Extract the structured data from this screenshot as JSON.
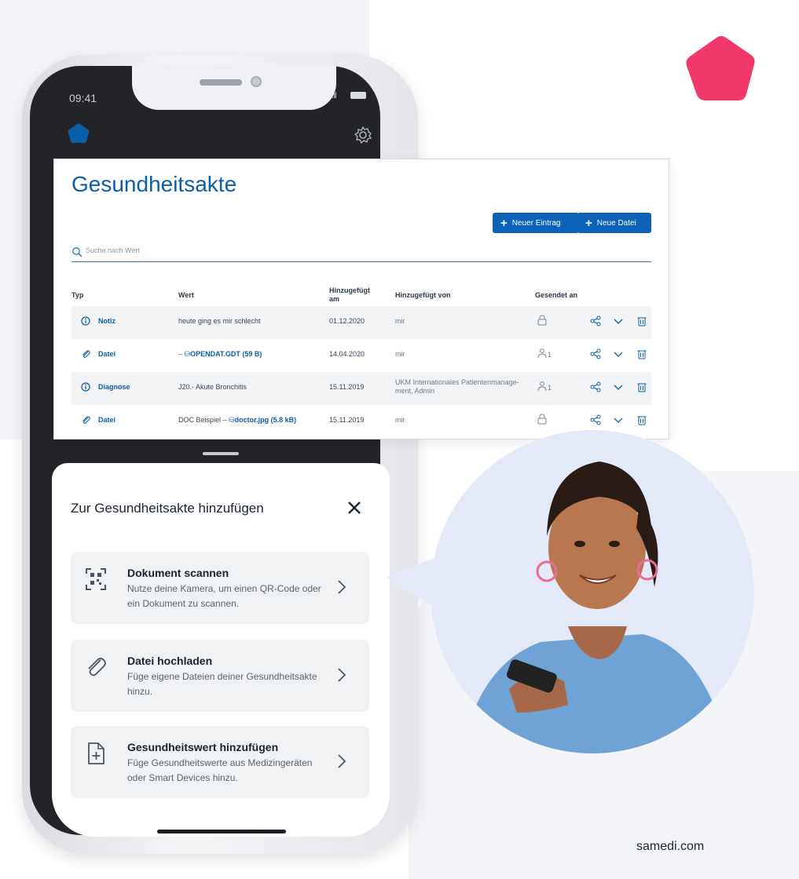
{
  "phone": {
    "status_time": "09:41",
    "status_signal": "..ıl"
  },
  "desktop": {
    "title": "Gesundheitsakte",
    "btn_new_entry": "Neuer Eintrag",
    "btn_new_file": "Neue Datei",
    "search_placeholder": "Suche nach Wert",
    "headers": {
      "typ": "Typ",
      "wert": "Wert",
      "added_at_line1": "Hinzugefügt",
      "added_at_line2": "am",
      "added_by": "Hinzugefügt von",
      "sent_to": "Gesendet an"
    },
    "rows": [
      {
        "type": "Notiz",
        "icon": "info-icon",
        "wert_prefix": "",
        "wert": "heute ging es mir schlecht",
        "date": "01.12.2020",
        "by_line1": "mir",
        "by_line2": "",
        "sent": "lock-icon",
        "count": ""
      },
      {
        "type": "Datei",
        "icon": "paperclip-icon",
        "wert_prefix": "– ",
        "wert": "OPENDAT.GDT (59 B)",
        "date": "14.04.2020",
        "by_line1": "mir",
        "by_line2": "",
        "sent": "users-icon",
        "count": "1"
      },
      {
        "type": "Diagnose",
        "icon": "info-icon",
        "wert_prefix": "",
        "wert": "J20.- Akute Bronchitis",
        "date": "15.11.2019",
        "by_line1": "UKM Internationales Patientenmanage-",
        "by_line2": "ment, Admin",
        "sent": "users-icon",
        "count": "1"
      },
      {
        "type": "Datei",
        "icon": "paperclip-icon",
        "wert_prefix": "DOC Beispiel – ",
        "wert": "doctor.jpg (5.8 kB)",
        "date": "15.11.2019",
        "by_line1": "mir",
        "by_line2": "",
        "sent": "lock-icon",
        "count": ""
      }
    ]
  },
  "sheet": {
    "title": "Zur Gesundheitsakte hinzufügen",
    "cards": [
      {
        "title": "Dokument scannen",
        "desc": "Nutze deine Kamera, um einen QR-Code oder ein Dokument zu scannen.",
        "icon": "qr-scan-icon"
      },
      {
        "title": "Datei hochladen",
        "desc": "Füge eigene Dateien deiner Gesundheitsakte hinzu.",
        "icon": "paperclip-icon"
      },
      {
        "title": "Gesundheitswert hinzufügen",
        "desc": "Füge Gesundheitswerte aus Medizingeräten oder Smart Devices hinzu.",
        "icon": "document-plus-icon"
      }
    ]
  },
  "footer": "samedi.com",
  "colors": {
    "accent": "#0b62b8",
    "brand_pink": "#f0396a",
    "dark": "#232427"
  }
}
